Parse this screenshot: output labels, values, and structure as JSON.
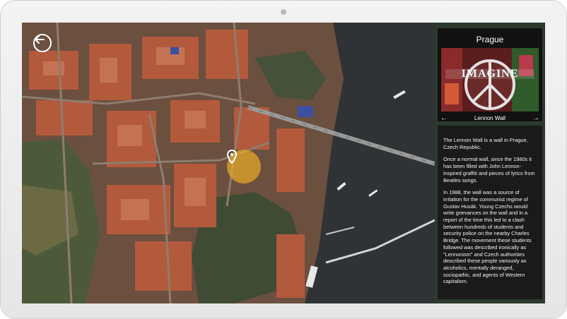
{
  "panel": {
    "title": "Prague",
    "photo_caption": "Lennon Wall",
    "photo_painted_word": "IMAGINE",
    "prev_arrow": "←",
    "next_arrow": "→",
    "paragraphs": [
      "The Lennon Wall is a wall in Prague, Czech Republic.",
      "Once a normal wall, since the 1980s it has been filled with John Lennon-inspired graffiti and pieces of lyrics from Beatles songs.",
      "In 1988, the wall was a source of irritation for the communist regime of Gustav Husák. Young Czechs would write grievances on the wall and in a report of the time this led to a clash between hundreds of students and security police on the nearby Charles Bridge. The movement these students followed was described ironically as \"Lennonism\" and Czech authorities described these people variously as alcoholics, mentally deranged, sociopathic, and agents of Western capitalism."
    ]
  },
  "icons": {
    "back": "back-arrow-icon",
    "pin": "map-pin-icon"
  },
  "colors": {
    "panel_bg": "#2b3a2f",
    "pin_glow": "#e8aa28",
    "river": "#2f3336",
    "roofs": "#b5553a"
  }
}
